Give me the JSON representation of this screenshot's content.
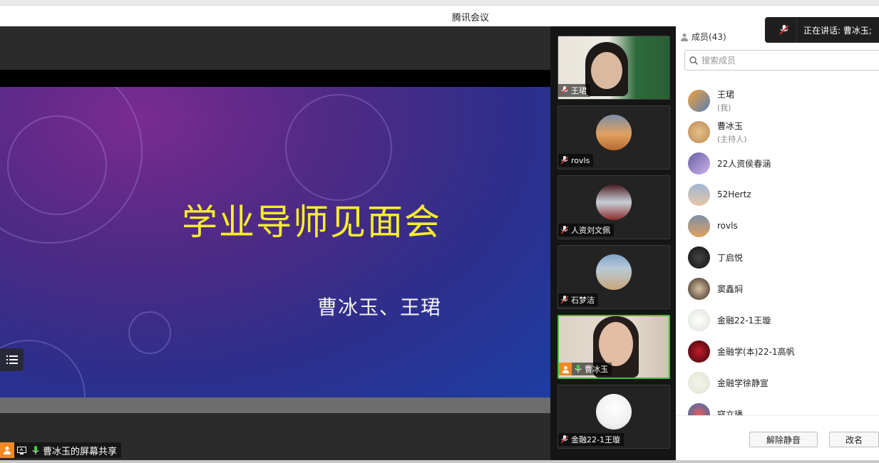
{
  "window": {
    "title": "腾讯会议"
  },
  "slide": {
    "title": "学业导师见面会",
    "subtitle": "曹冰玉、王珺"
  },
  "share": {
    "label": "曹冰玉的屏幕共享"
  },
  "speaking": {
    "label": "正在讲话: 曹冰玉;"
  },
  "videos": [
    {
      "name": "王珺",
      "mic": "muted",
      "type": "camera"
    },
    {
      "name": "rovls",
      "mic": "muted",
      "type": "avatar",
      "avatar": "sunset"
    },
    {
      "name": "人资刘文佩",
      "mic": "muted",
      "type": "avatar",
      "avatar": "room"
    },
    {
      "name": "石梦洁",
      "mic": "muted",
      "type": "avatar",
      "avatar": "girl-tree"
    },
    {
      "name": "曹冰玉",
      "mic": "active",
      "type": "camera",
      "host": true
    },
    {
      "name": "金融22-1王璇",
      "mic": "muted",
      "type": "avatar",
      "avatar": "sketch"
    }
  ],
  "panel": {
    "members_label": "成员(43)",
    "search_placeholder": "搜索成员",
    "members": [
      {
        "name": "王珺",
        "sub": "(我)",
        "avatar": "orange"
      },
      {
        "name": "曹冰玉",
        "sub": "(主持人)",
        "avatar": "dog"
      },
      {
        "name": "22人资侯春涵",
        "sub": "",
        "avatar": "purple"
      },
      {
        "name": "52Hertz",
        "sub": "",
        "avatar": "sky"
      },
      {
        "name": "rovls",
        "sub": "",
        "avatar": "sunset"
      },
      {
        "name": "丁启悦",
        "sub": "",
        "avatar": "dark"
      },
      {
        "name": "窦鑫焖",
        "sub": "",
        "avatar": "child"
      },
      {
        "name": "金融22-1王璇",
        "sub": "",
        "avatar": "sketch"
      },
      {
        "name": "金融学(本)22-1高帆",
        "sub": "",
        "avatar": "red"
      },
      {
        "name": "金融学徐静宣",
        "sub": "",
        "avatar": "plant"
      },
      {
        "name": "寇立璠",
        "sub": "",
        "avatar": "toy"
      }
    ],
    "unmute_label": "解除静音",
    "rename_label": "改名"
  }
}
